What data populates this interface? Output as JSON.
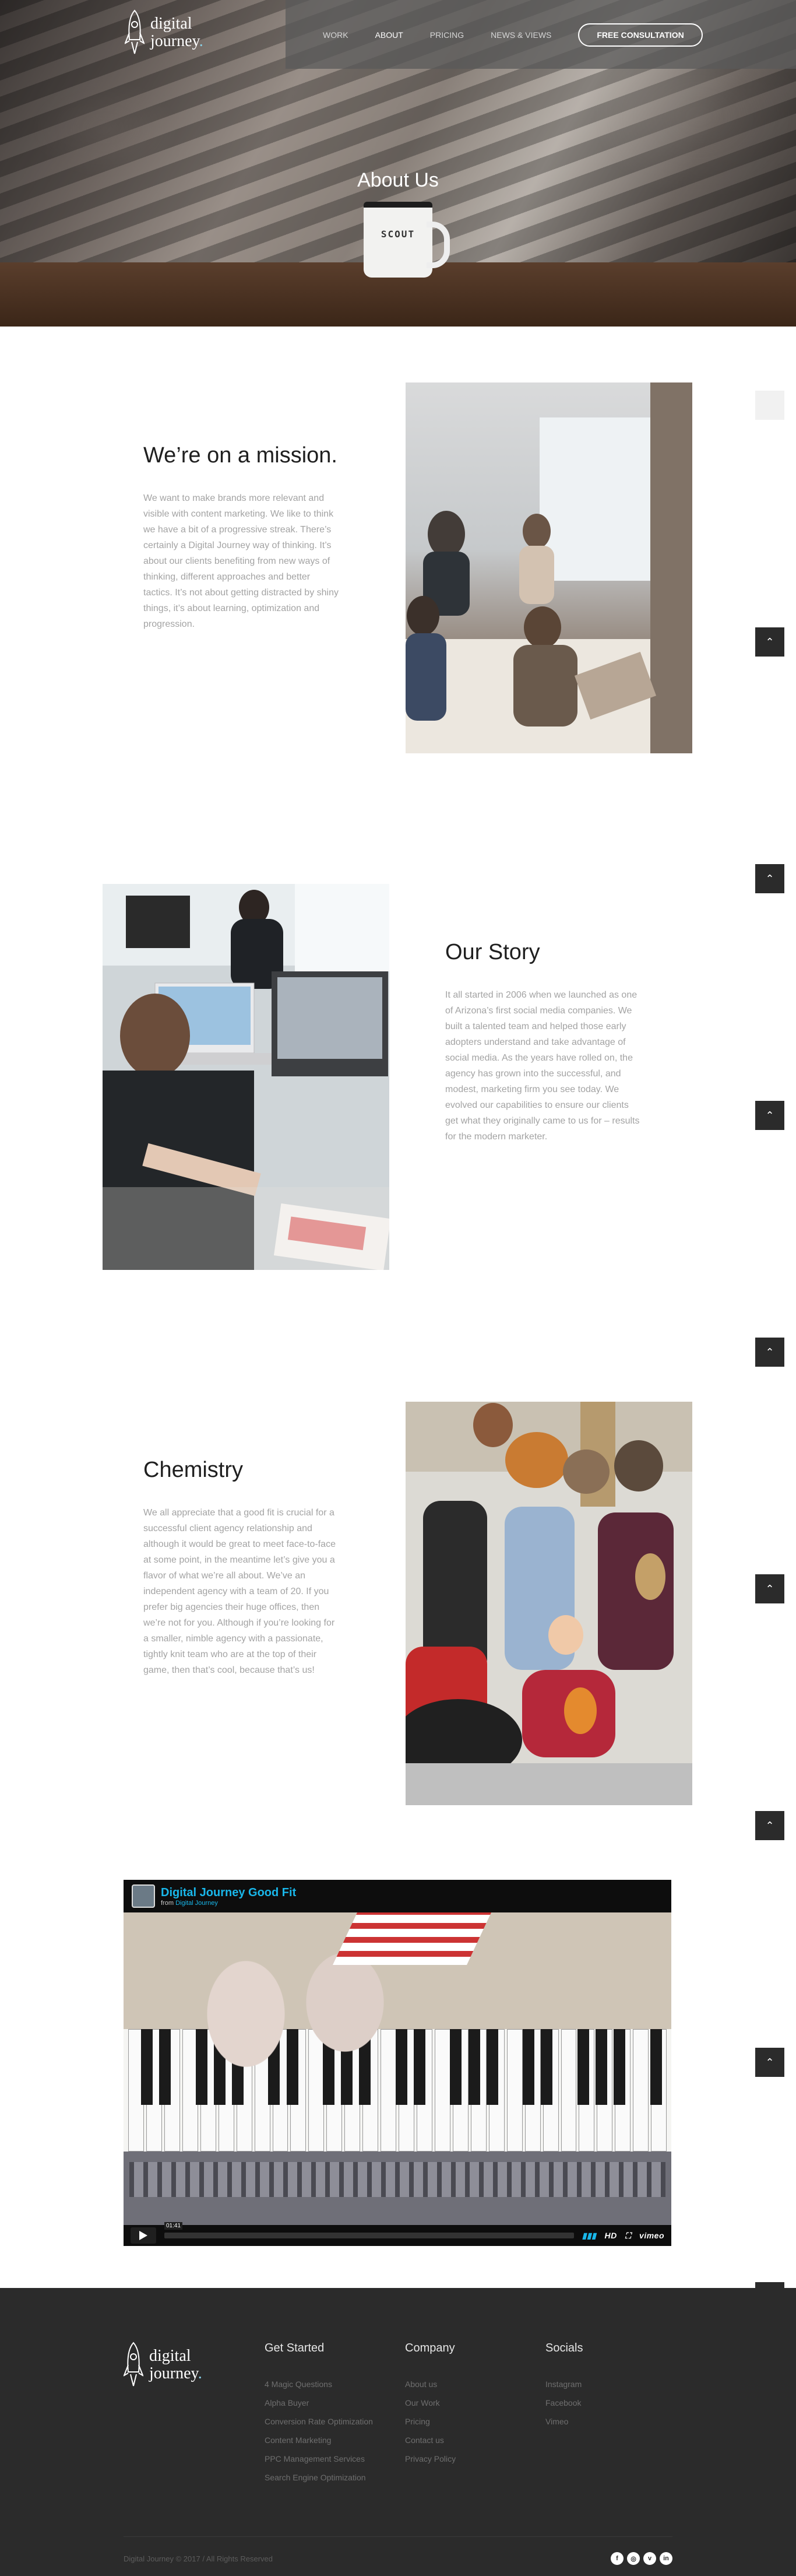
{
  "brand": {
    "line1": "digital",
    "line2": "journey",
    "dot": "."
  },
  "nav": {
    "items": [
      {
        "label": "WORK"
      },
      {
        "label": "ABOUT"
      },
      {
        "label": "PRICING"
      },
      {
        "label": "NEWS & VIEWS"
      }
    ],
    "cta": "FREE CONSULTATION"
  },
  "hero": {
    "title": "About Us",
    "mug_text": "SCOUT"
  },
  "sections": [
    {
      "title": "We’re on a mission.",
      "body": "We want to make brands more relevant and visible with content marketing. We like to think we have a bit of a progressive streak. There’s certainly a Digital Journey way of thinking. It’s about our clients benefiting from new ways of thinking, different approaches and better tactics. It’s not about getting distracted by shiny things, it’s about learning, optimization and progression."
    },
    {
      "title": "Our Story",
      "body": "It all started in 2006 when we launched as one of Arizona’s first social media companies. We built a talented team and helped those early adopters understand and take advantage of social media. As the years have rolled on, the agency has grown into the successful, and modest, marketing firm you see today. We evolved our capabilities to ensure our clients get what they originally came to us for – results for the modern marketer."
    },
    {
      "title": "Chemistry",
      "body": "We all appreciate that a good fit is crucial for a successful client agency relationship and although it would be great to meet face-to-face at some point, in the meantime let’s give you a flavor of what we’re all about. We’ve an independent agency with a team of 20. If you prefer big agencies their huge offices, then we’re not for you. Although if you’re looking for a smaller, nimble agency with a passionate, tightly knit team who are at the top of their game, then that’s cool, because that’s us!"
    }
  ],
  "video": {
    "title": "Digital Journey Good Fit",
    "from_prefix": "from",
    "from_name": "Digital Journey",
    "time": "01:41",
    "hd": "HD",
    "vimeo": "vimeo"
  },
  "footer": {
    "columns": [
      {
        "heading": "Get Started",
        "links": [
          "4 Magic Questions",
          "Alpha Buyer",
          "Conversion Rate Optimization",
          "Content Marketing",
          "PPC Management Services",
          "Search Engine Optimization"
        ]
      },
      {
        "heading": "Company",
        "links": [
          "About us",
          "Our Work",
          "Pricing",
          "Contact us",
          "Privacy Policy"
        ]
      },
      {
        "heading": "Socials",
        "links": [
          "Instagram",
          "Facebook",
          "Vimeo"
        ]
      }
    ],
    "copyright": "Digital Journey © 2017 / All Rights Reserved",
    "social_icons": [
      "facebook-icon",
      "instagram-icon",
      "vimeo-icon",
      "linkedin-icon"
    ]
  },
  "colors": {
    "footer_bg": "#2b2b2b",
    "accent": "#8ad1e7",
    "vimeo_blue": "#19b7ea"
  }
}
